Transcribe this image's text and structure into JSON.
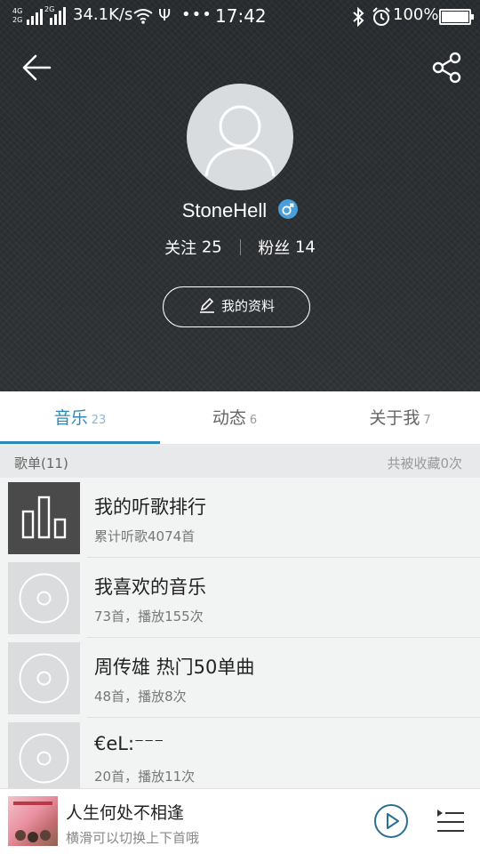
{
  "status_bar": {
    "network_top": "4G",
    "network_bottom": "2G",
    "network_2g_label": "2G",
    "speed": "34.1K/s",
    "more": "•••",
    "time": "17:42",
    "battery": "100%"
  },
  "profile": {
    "username": "StoneHell",
    "following_label": "关注",
    "following_count": "25",
    "fans_label": "粉丝",
    "fans_count": "14",
    "edit_button": "我的资料"
  },
  "tabs": [
    {
      "label": "音乐",
      "count": "23",
      "active": true
    },
    {
      "label": "动态",
      "count": "6",
      "active": false
    },
    {
      "label": "关于我",
      "count": "7",
      "active": false
    }
  ],
  "section": {
    "title": "歌单(11)",
    "right": "共被收藏0次"
  },
  "playlists": [
    {
      "title": "我的听歌排行",
      "subtitle": "累计听歌4074首",
      "icon": "ranking-bars-icon"
    },
    {
      "title": "我喜欢的音乐",
      "subtitle": "73首，播放155次",
      "icon": "disc-icon"
    },
    {
      "title": "周传雄 热门50单曲",
      "subtitle": "48首，播放8次",
      "icon": "disc-icon"
    },
    {
      "title": "€eL:⁻⁻⁻",
      "subtitle": "20首，播放11次",
      "icon": "disc-icon"
    }
  ],
  "player": {
    "song": "人生何处不相逢",
    "hint": "横滑可以切换上下首哦"
  },
  "colors": {
    "accent": "#2a89b8",
    "header_bg": "#2a2e31",
    "gender_badge": "#4a9fd8"
  }
}
